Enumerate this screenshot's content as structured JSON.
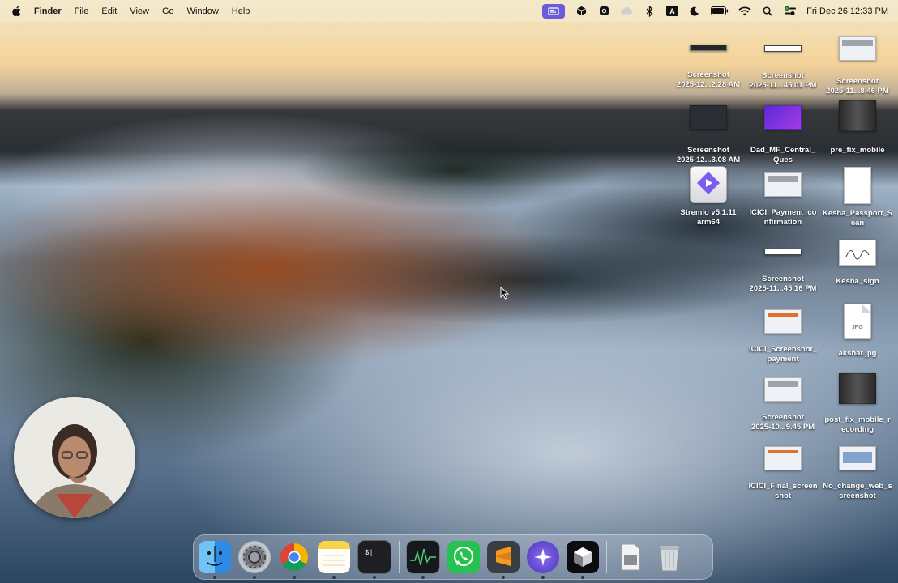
{
  "menubar": {
    "app_name": "Finder",
    "menus": [
      "File",
      "Edit",
      "View",
      "Go",
      "Window",
      "Help"
    ],
    "status_icons": [
      "screen-share-icon",
      "package-icon",
      "record-icon",
      "cloud-icon",
      "bluetooth-icon",
      "input-source-icon",
      "moon-icon",
      "battery-icon",
      "wifi-icon",
      "search-icon",
      "control-center-icon"
    ],
    "input_source": "A",
    "clock": "Fri Dec 26  12:33 PM"
  },
  "desktop": {
    "icons": [
      {
        "label": "Screenshot\n2025-12...2.28 AM",
        "style": "lineblk"
      },
      {
        "label": "Screenshot\n2025-11...45.01 PM",
        "style": "line"
      },
      {
        "label": "Screenshot\n2025-11...8.46 PM",
        "style": "screen"
      },
      {
        "label": "Screenshot\n2025-12...3.08 AM",
        "style": "dark"
      },
      {
        "label": "Dad_MF_Central_\nQues",
        "style": "purple"
      },
      {
        "label": "pre_fix_mobile",
        "style": "phone"
      },
      {
        "label": "Stremio v5.1.11\narm64",
        "style": "app"
      },
      {
        "label": "ICICI_Payment_co\nnfirmation",
        "style": "screen"
      },
      {
        "label": "Kesha_Passport_S\ncan",
        "style": "doc"
      },
      {
        "label": "Screenshot\n2025-11...45.16 PM",
        "style": "line"
      },
      {
        "label": "Kesha_sign",
        "style": "sign"
      },
      {
        "label": "ICICI_Screenshot_\npayment",
        "style": "orange"
      },
      {
        "label": "akshat.jpg",
        "style": "jpg"
      },
      {
        "label": "Screenshot\n2025-10...9.45 PM",
        "style": "screen"
      },
      {
        "label": "post_fix_mobile_r\necording",
        "style": "phone"
      },
      {
        "label": "ICICI_Final_screen\nshot",
        "style": "orange"
      },
      {
        "label": "No_change_web_s\ncreenshot",
        "style": "web"
      }
    ]
  },
  "dock": {
    "apps": [
      "finder-icon",
      "system-settings-icon",
      "chrome-icon",
      "notes-icon",
      "terminal-icon",
      "activity-monitor-icon",
      "whatsapp-icon",
      "sublime-text-icon",
      "perplexity-icon",
      "cursor-app-icon",
      "preview-icon",
      "trash-icon"
    ],
    "terminal_glyph": "$|"
  }
}
